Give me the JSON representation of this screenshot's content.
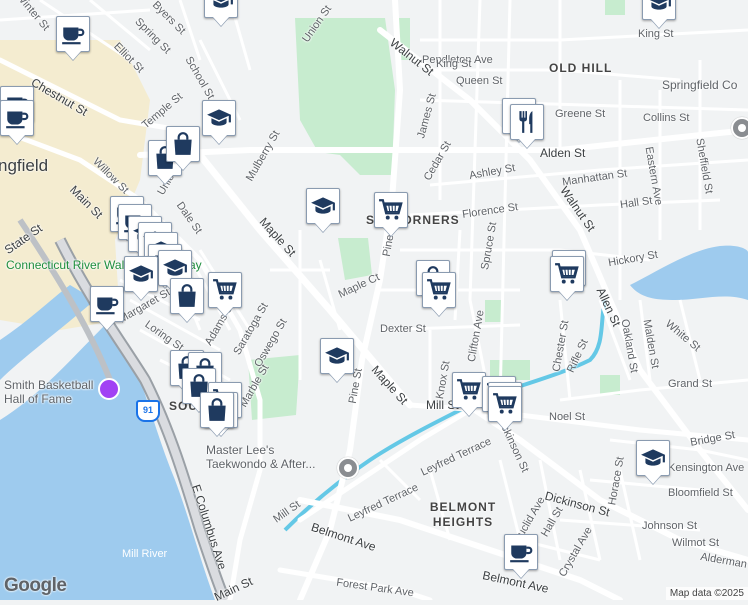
{
  "map": {
    "attribution": "Map data ©2025",
    "logo": "Google",
    "city_label": "ngfield",
    "neighborhoods": [
      {
        "id": "old-hill",
        "name": "OLD HILL"
      },
      {
        "id": "six-corners",
        "name": "SIX CORNERS"
      },
      {
        "id": "belmont-heights",
        "name": "BELMONT HEIGHTS"
      },
      {
        "id": "south-end",
        "name": "SOU"
      }
    ],
    "pois": [
      {
        "id": "riverwalk",
        "name": "Connecticut River Walk and Bikeway"
      },
      {
        "id": "hall-of-fame",
        "name": "Smith Basketball Hall of Fame"
      },
      {
        "id": "taekwondo",
        "name": "Master Lee's Taekwondo & After..."
      },
      {
        "id": "springfield-college",
        "name": "Springfield Co"
      },
      {
        "id": "mill-river",
        "name": "Mill River"
      }
    ],
    "highway_shield": "91",
    "streets": [
      "Winter St",
      "Byers St",
      "Spring St",
      "Elliot St",
      "Union St",
      "Chestnut St",
      "School St",
      "Temple St",
      "Mulberry St",
      "Willow St",
      "Main St",
      "State St",
      "Union St",
      "Dale St",
      "Maple St",
      "Maple St",
      "Maple Ct",
      "Margaret St",
      "Loring St",
      "Adams St",
      "Saratoga St",
      "Oswego St",
      "Marble St",
      "Mill St",
      "Mill St",
      "Pine St",
      "Pine St",
      "Walnut St",
      "Walnut St",
      "Pendleton Ave",
      "King St",
      "King St",
      "Queen St",
      "James St",
      "Greene St",
      "Collins St",
      "Alden St",
      "Cedar St",
      "Ashley St",
      "Manhattan St",
      "Eastern Ave",
      "Sheffield St",
      "Florence St",
      "Hall St",
      "Hickory St",
      "Spruce St",
      "Dexter St",
      "Clifton Ave",
      "Knox St",
      "Chester St",
      "Rifle St",
      "Allen St",
      "Oakland St",
      "Malden St",
      "White St",
      "Grand St",
      "Noel St",
      "Dickinson St",
      "Dickinson St",
      "Leyfred Terrace",
      "Leyfred Terrace",
      "Belmont Ave",
      "Belmont Ave",
      "Euclid Ave",
      "Hall St",
      "Crystal Ave",
      "Horace St",
      "Kensington Ave",
      "Bloomfield St",
      "Johnson St",
      "Wilmot St",
      "Alderman St",
      "E Columbus Ave",
      "Forest Park Ave",
      "Main St",
      "Bridge St"
    ],
    "markers": [
      {
        "type": "education"
      },
      {
        "type": "cafe"
      },
      {
        "type": "education"
      },
      {
        "type": "cafe"
      },
      {
        "type": "cafe"
      },
      {
        "type": "shopping"
      },
      {
        "type": "shopping"
      },
      {
        "type": "education"
      },
      {
        "type": "cafe"
      },
      {
        "type": "cafe"
      },
      {
        "type": "education"
      },
      {
        "type": "education"
      },
      {
        "type": "education"
      },
      {
        "type": "cafe"
      },
      {
        "type": "education"
      },
      {
        "type": "cafe"
      },
      {
        "type": "shopping"
      },
      {
        "type": "grocery"
      },
      {
        "type": "education"
      },
      {
        "type": "shopping"
      },
      {
        "type": "shopping"
      },
      {
        "type": "shopping"
      },
      {
        "type": "grocery"
      },
      {
        "type": "shopping"
      },
      {
        "type": "shopping"
      },
      {
        "type": "education"
      },
      {
        "type": "grocery"
      },
      {
        "type": "restaurant"
      },
      {
        "type": "restaurant"
      },
      {
        "type": "education"
      },
      {
        "type": "shopping"
      },
      {
        "type": "grocery"
      },
      {
        "type": "grocery"
      },
      {
        "type": "grocery"
      },
      {
        "type": "grocery"
      },
      {
        "type": "grocery"
      },
      {
        "type": "grocery"
      },
      {
        "type": "grocery"
      },
      {
        "type": "education"
      },
      {
        "type": "cafe"
      }
    ],
    "colors": {
      "water": "#9ecbee",
      "park": "#c7eccf",
      "road": "#ffffff",
      "highway": "#9aa0a6",
      "background": "#f1f3f4",
      "downtown": "#f4ecd0",
      "marker_icon": "#1f3a5f",
      "canal": "#64c8e6"
    }
  }
}
